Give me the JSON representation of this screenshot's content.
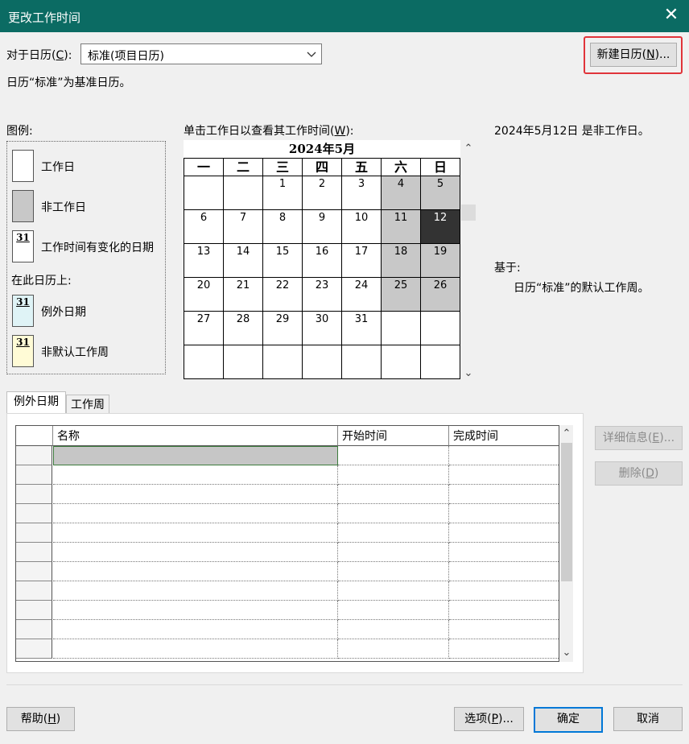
{
  "window": {
    "title": "更改工作时间",
    "close_glyph": "✕"
  },
  "header": {
    "for_calendar_label": "对于日历(C):",
    "for_calendar_prefix": "对于日历(",
    "for_calendar_key": "C",
    "for_calendar_suffix": "):",
    "calendar_value": "标准(项目日历)",
    "base_note": "日历“标准”为基准日历。",
    "new_calendar_prefix": "新建日历(",
    "new_calendar_key": "N",
    "new_calendar_suffix": ")..."
  },
  "legend": {
    "title": "图例:",
    "items": [
      {
        "label": "工作日",
        "kind": "working"
      },
      {
        "label": "非工作日",
        "kind": "nonworking"
      },
      {
        "label": "工作时间有变化的日期",
        "kind": "changed",
        "badge": "31"
      }
    ],
    "on_this_calendar": "在此日历上:",
    "calendar_items": [
      {
        "label": "例外日期",
        "kind": "exception",
        "badge": "31",
        "color": "#dff3f6"
      },
      {
        "label": "非默认工作周",
        "kind": "nondefault",
        "badge": "31",
        "color": "#fffbd6"
      }
    ]
  },
  "calendar": {
    "instruction_prefix": "单击工作日以查看其工作时间(",
    "instruction_key": "W",
    "instruction_suffix": "):",
    "month_title": "2024年5月",
    "weekdays": [
      "一",
      "二",
      "三",
      "四",
      "五",
      "六",
      "日"
    ],
    "weeks": [
      [
        "",
        "",
        "1",
        "2",
        "3",
        "4",
        "5"
      ],
      [
        "6",
        "7",
        "8",
        "9",
        "10",
        "11",
        "12"
      ],
      [
        "13",
        "14",
        "15",
        "16",
        "17",
        "18",
        "19"
      ],
      [
        "20",
        "21",
        "22",
        "23",
        "24",
        "25",
        "26"
      ],
      [
        "27",
        "28",
        "29",
        "30",
        "31",
        "",
        ""
      ],
      [
        "",
        "",
        "",
        "",
        "",
        "",
        ""
      ]
    ],
    "selected_day": "12",
    "colors": {
      "nonworking": "#c8c8c8",
      "selected": "#333333"
    }
  },
  "info": {
    "status": "2024年5月12日 是非工作日。",
    "based_on_label": "基于:",
    "based_on_value": "日历“标准”的默认工作周。"
  },
  "tabs": [
    {
      "label": "例外日期",
      "active": true
    },
    {
      "label": "工作周",
      "active": false
    }
  ],
  "exceptions_table": {
    "columns": [
      "名称",
      "开始时间",
      "完成时间"
    ],
    "row_count": 11
  },
  "side_buttons": {
    "details_prefix": "详细信息(",
    "details_key": "E",
    "details_suffix": ")...",
    "delete_prefix": "删除(",
    "delete_key": "D",
    "delete_suffix": ")"
  },
  "footer": {
    "help_prefix": "帮助(",
    "help_key": "H",
    "help_suffix": ")",
    "options_prefix": "选项(",
    "options_key": "P",
    "options_suffix": ")...",
    "ok": "确定",
    "cancel": "取消"
  },
  "accent": {
    "titlebar": "#0b6b63",
    "highlight": "#e0343a",
    "default_button_border": "#0078d7"
  }
}
